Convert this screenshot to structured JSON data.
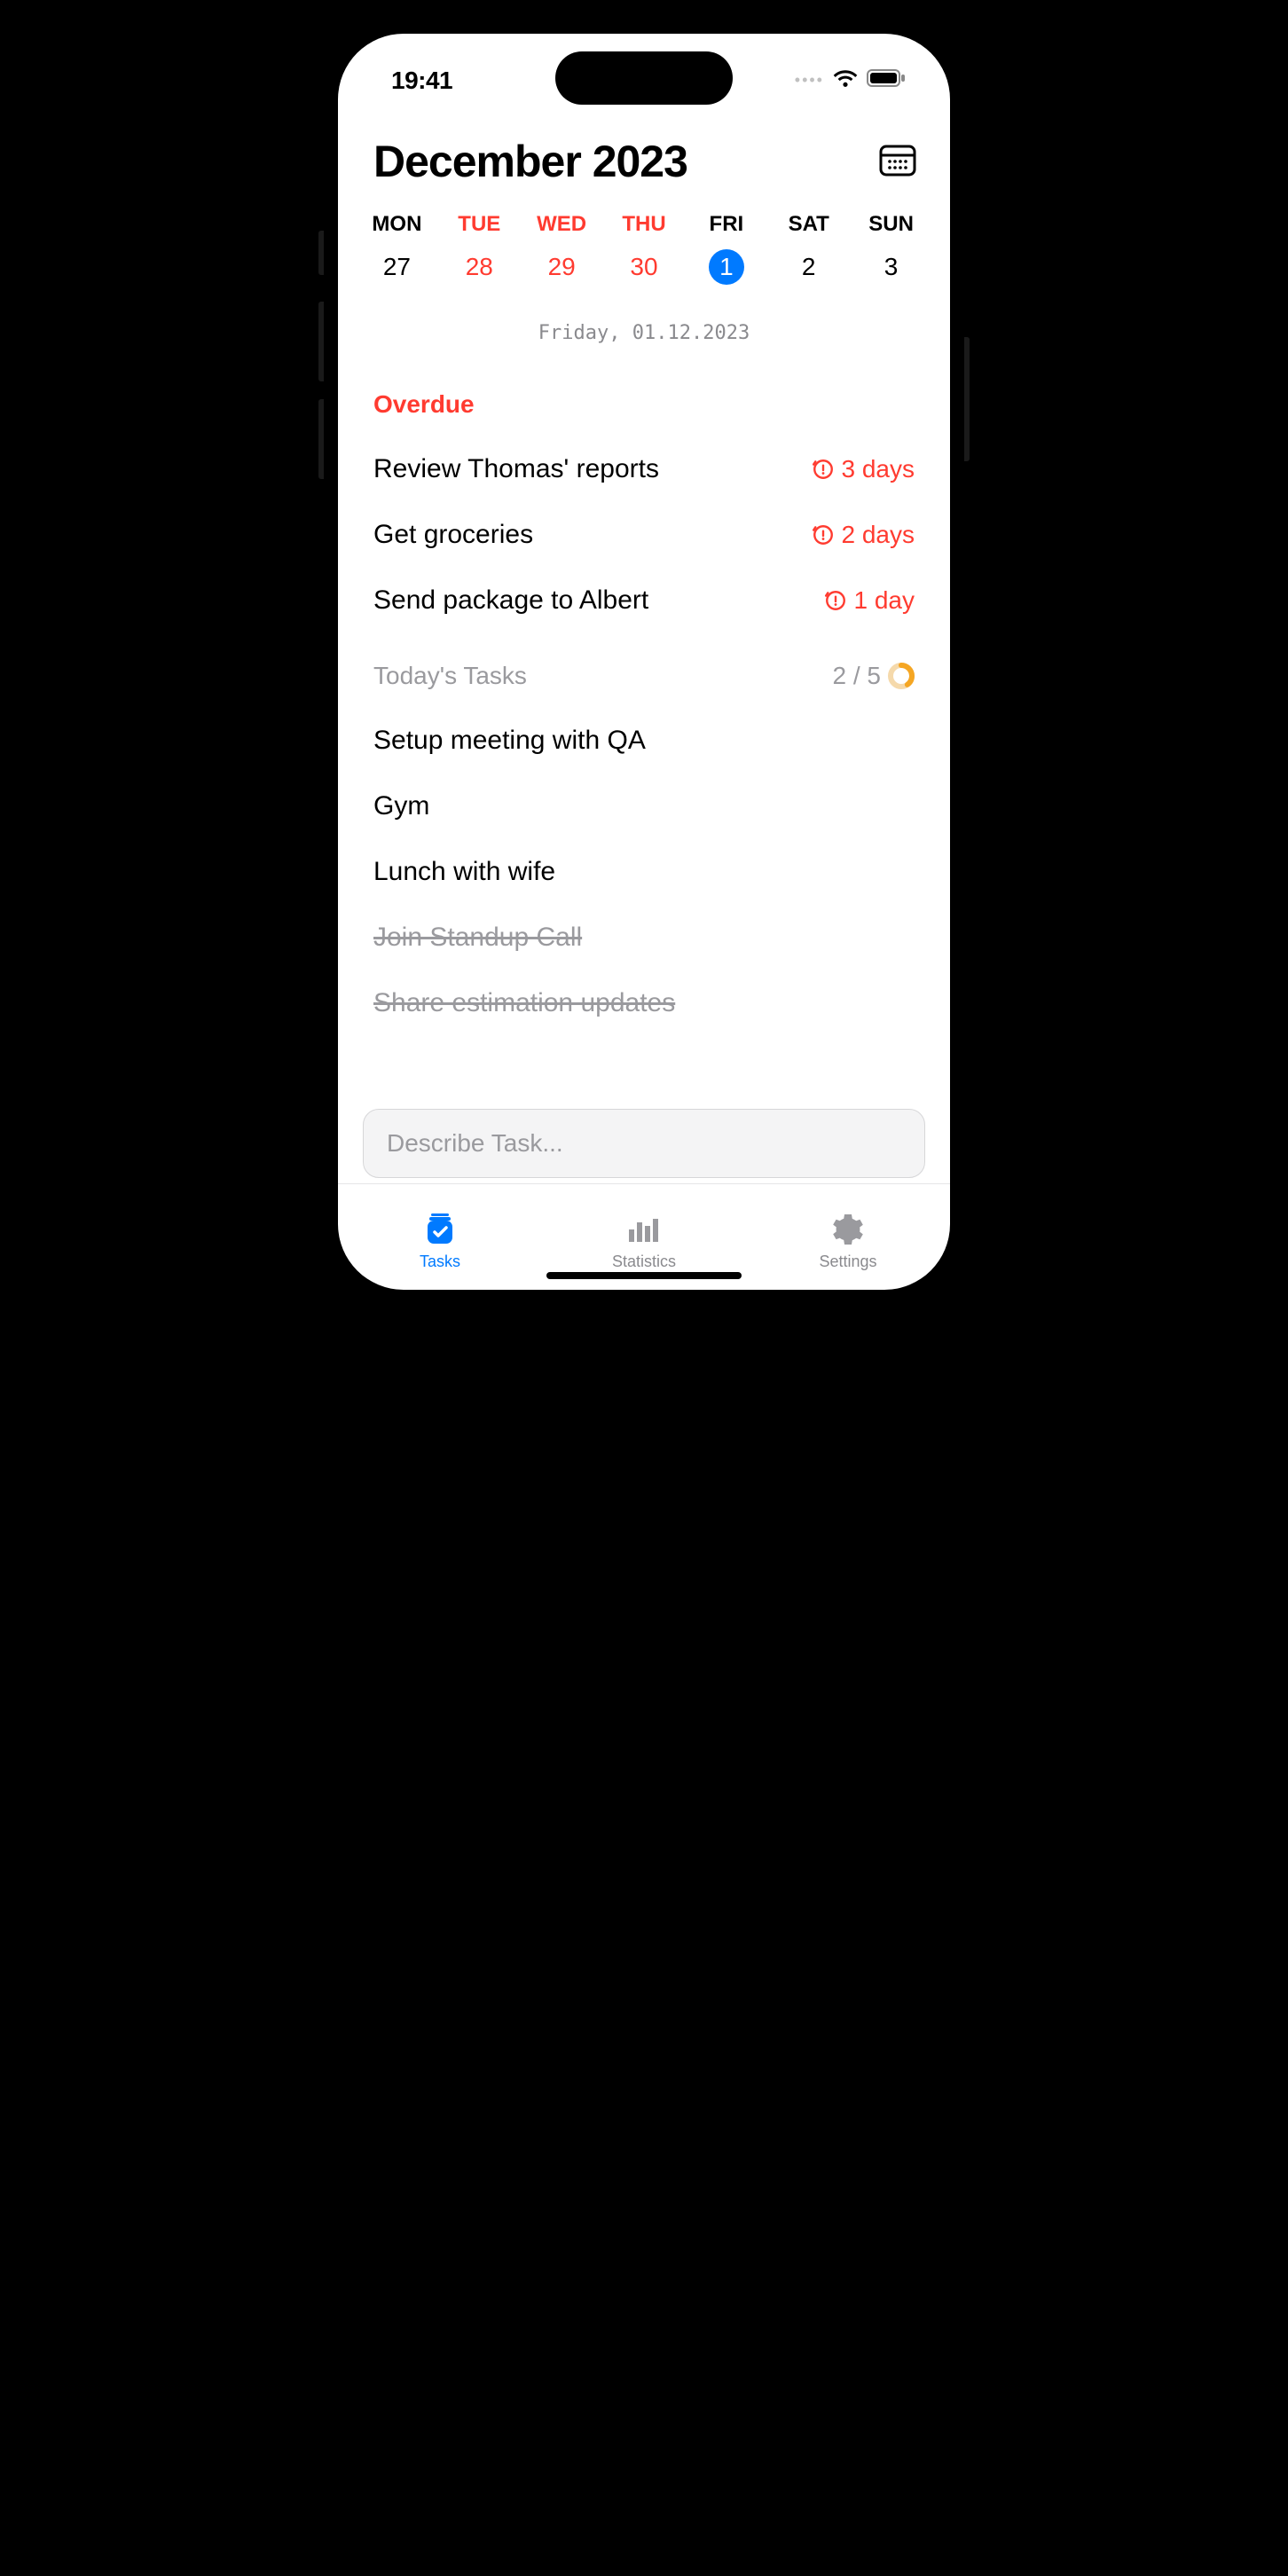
{
  "status": {
    "time": "19:41"
  },
  "header": {
    "month": "December 2023"
  },
  "week": {
    "days": [
      {
        "name": "MON",
        "num": "27",
        "state": "past"
      },
      {
        "name": "TUE",
        "num": "28",
        "state": "past-red"
      },
      {
        "name": "WED",
        "num": "29",
        "state": "past-red"
      },
      {
        "name": "THU",
        "num": "30",
        "state": "past-red"
      },
      {
        "name": "FRI",
        "num": "1",
        "state": "today"
      },
      {
        "name": "SAT",
        "num": "2",
        "state": "future"
      },
      {
        "name": "SUN",
        "num": "3",
        "state": "future"
      }
    ]
  },
  "current_date": "Friday, 01.12.2023",
  "sections": {
    "overdue": {
      "title": "Overdue",
      "items": [
        {
          "text": "Review Thomas' reports",
          "badge": "3 days"
        },
        {
          "text": "Get groceries",
          "badge": "2 days"
        },
        {
          "text": "Send package to Albert",
          "badge": "1 day"
        }
      ]
    },
    "today": {
      "title": "Today's Tasks",
      "progress": "2 / 5",
      "progress_ratio": 0.4,
      "items": [
        {
          "text": "Setup meeting with QA",
          "done": false
        },
        {
          "text": "Gym",
          "done": false
        },
        {
          "text": "Lunch with wife",
          "done": false
        },
        {
          "text": "Join Standup Call",
          "done": true
        },
        {
          "text": "Share estimation updates",
          "done": true
        }
      ]
    }
  },
  "input": {
    "placeholder": "Describe Task..."
  },
  "tabs": [
    {
      "label": "Tasks",
      "icon": "tasks",
      "active": true
    },
    {
      "label": "Statistics",
      "icon": "stats",
      "active": false
    },
    {
      "label": "Settings",
      "icon": "settings",
      "active": false
    }
  ],
  "colors": {
    "accent": "#007aff",
    "danger": "#ff3b30",
    "muted": "#9a9a9e",
    "progress": "#f5a623"
  }
}
